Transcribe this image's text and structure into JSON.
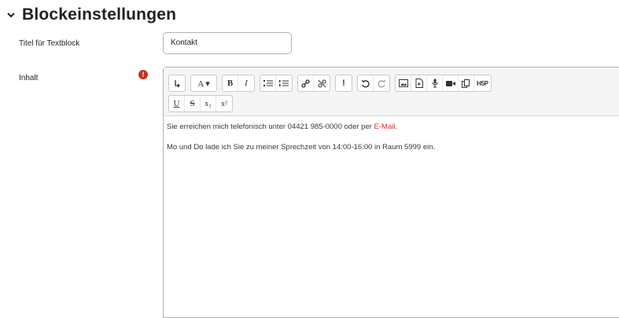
{
  "section": {
    "title": "Blockeinstellungen"
  },
  "fields": {
    "title_label": "Titel für Textblock",
    "title_value": "Kontakt",
    "content_label": "Inhalt",
    "required_mark": "!"
  },
  "toolbar": {
    "row1": [
      {
        "name": "toolbar-toggle-button",
        "label": "↴"
      },
      {
        "name": "font-size-button",
        "label": "A ▾"
      },
      {
        "name": "bold-button",
        "label": "B"
      },
      {
        "name": "italic-button",
        "label": "I"
      },
      {
        "name": "unordered-list-button",
        "label": ""
      },
      {
        "name": "ordered-list-button",
        "label": ""
      },
      {
        "name": "link-button",
        "label": ""
      },
      {
        "name": "unlink-button",
        "label": ""
      },
      {
        "name": "prevent-autolink-button",
        "label": "!"
      },
      {
        "name": "undo-button",
        "label": ""
      },
      {
        "name": "redo-button",
        "label": ""
      },
      {
        "name": "image-button",
        "label": ""
      },
      {
        "name": "media-button",
        "label": ""
      },
      {
        "name": "record-audio-button",
        "label": ""
      },
      {
        "name": "record-video-button",
        "label": ""
      },
      {
        "name": "manage-files-button",
        "label": ""
      },
      {
        "name": "h5p-button",
        "label": "H5P"
      }
    ],
    "row2": [
      {
        "name": "underline-button",
        "label": "U"
      },
      {
        "name": "strikethrough-button",
        "label": "S"
      },
      {
        "name": "subscript-button",
        "label": "x₂"
      },
      {
        "name": "superscript-button",
        "label": "x²"
      }
    ]
  },
  "content": {
    "line1_prefix": "Sie erreichen mich telefonisch unter 04421 985-0000 oder per ",
    "line1_link": "E-Mail",
    "line1_suffix": ".",
    "line2": "Mo und Do lade ich Sie zu meiner Sprechzeit von 14:00-16:00 in Raum 5999 ein."
  },
  "colors": {
    "required": "#ca3120",
    "link": "#d32f2f"
  }
}
